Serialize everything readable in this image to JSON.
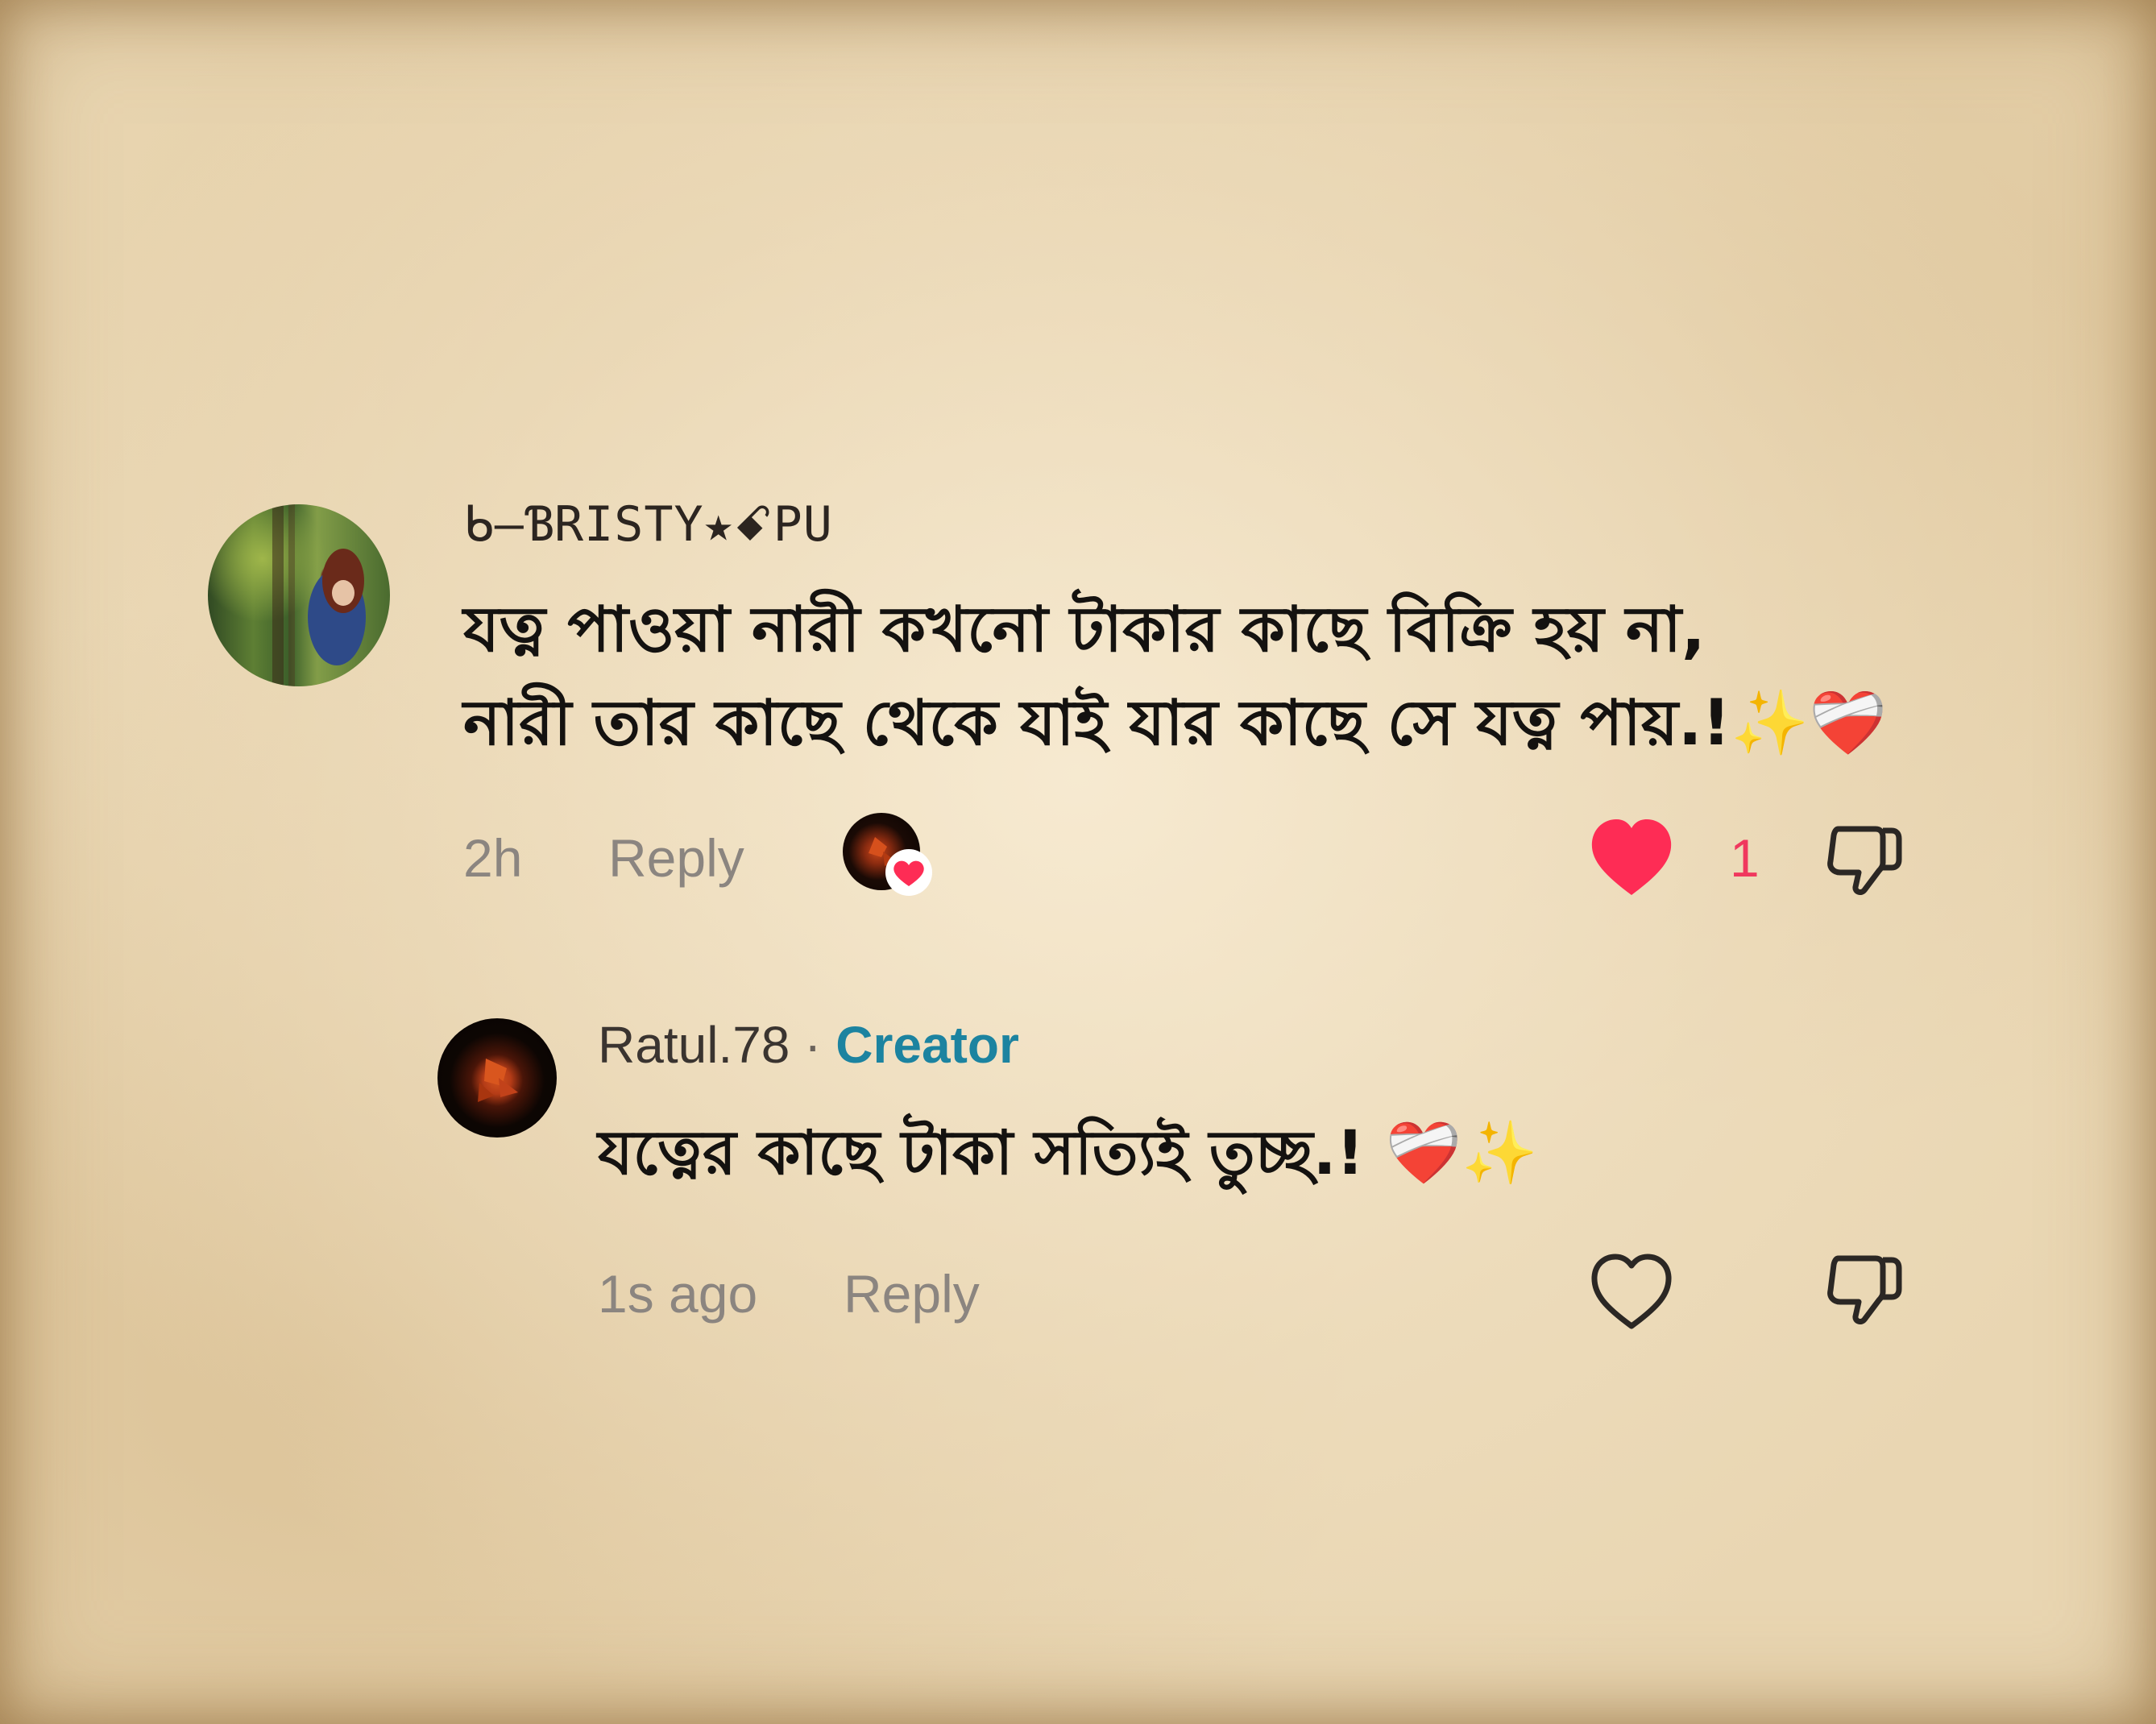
{
  "comments": [
    {
      "username": "ᑲ—ƁRISTY★ꗃPU",
      "avatar_icon": "profile-photo-woman-in-garden",
      "text_lines": [
        "যত্ন পাওয়া নারী কখনো টাকার কাছে বিক্রি হয় না,",
        "নারী তার কাছে থেকে যাই যার কাছে সে যত্ন পায়.!✨❤️‍🩹"
      ],
      "time": "2h",
      "reply_label": "Reply",
      "liked_by_creator_icon": "creator-avatar-with-heart",
      "like_icon": "heart-filled-icon",
      "like_count": "1",
      "dislike_icon": "thumbs-down-icon"
    },
    {
      "username": "Ratul.78",
      "separator": " · ",
      "badge": "Creator",
      "avatar_icon": "profile-photo-red-flower",
      "text": "যত্নের কাছে টাকা সত্যিই তুচ্ছ.! ❤️‍🩹✨",
      "time": "1s ago",
      "reply_label": "Reply",
      "like_icon": "heart-outline-icon",
      "dislike_icon": "thumbs-down-icon"
    }
  ],
  "colors": {
    "like_active": "#fe2c55",
    "creator_badge": "#1c83a0",
    "meta_text": "#8b8580"
  }
}
